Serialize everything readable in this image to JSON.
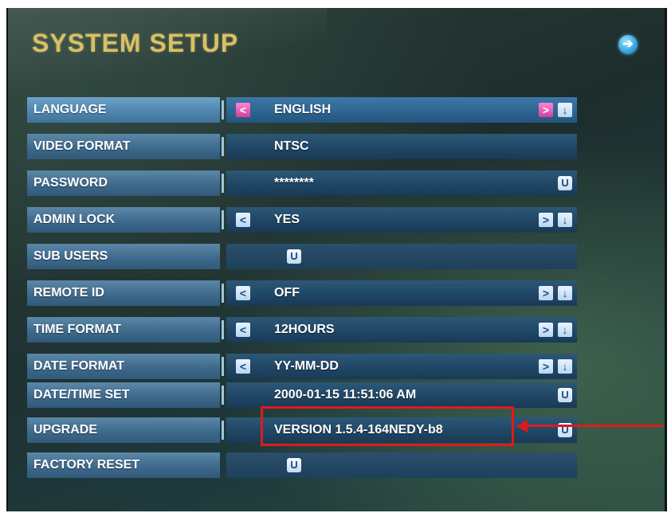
{
  "title": "SYSTEM SETUP",
  "icons": {
    "back": "back-arrow-icon",
    "left": "left-arrow-icon",
    "right": "right-arrow-icon",
    "down": "down-arrow-icon",
    "enter": "enter-icon"
  },
  "colors": {
    "title": "#d8c064",
    "highlight": "#e01a1a",
    "selected_arrow": "#d2409a"
  },
  "rows": [
    {
      "label": "LANGUAGE",
      "value": "ENGLISH"
    },
    {
      "label": "VIDEO FORMAT",
      "value": "NTSC"
    },
    {
      "label": "PASSWORD",
      "value": "********"
    },
    {
      "label": "ADMIN LOCK",
      "value": "YES"
    },
    {
      "label": "SUB USERS",
      "value": ""
    },
    {
      "label": "REMOTE ID",
      "value": "OFF"
    },
    {
      "label": "TIME FORMAT",
      "value": "12HOURS"
    },
    {
      "label": "DATE FORMAT",
      "value": "YY-MM-DD"
    },
    {
      "label": "DATE/TIME SET",
      "value": "2000-01-15 11:51:06 AM"
    },
    {
      "label": "UPGRADE",
      "value": "VERSION 1.5.4-164NEDY-b8"
    },
    {
      "label": "FACTORY RESET",
      "value": ""
    }
  ]
}
